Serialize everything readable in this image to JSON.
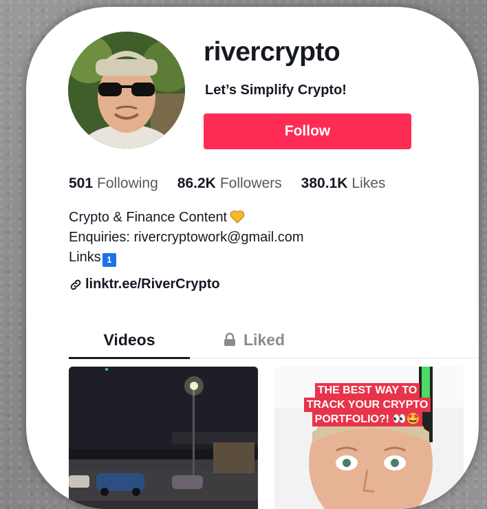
{
  "profile": {
    "username": "rivercrypto",
    "tagline": "Let’s Simplify Crypto!",
    "follow_label": "Follow"
  },
  "stats": [
    {
      "value": "501",
      "label": "Following"
    },
    {
      "value": "86.2K",
      "label": "Followers"
    },
    {
      "value": "380.1K",
      "label": "Likes"
    }
  ],
  "bio": {
    "line1": "Crypto & Finance Content",
    "line2": "Enquiries: rivercryptowork@gmail.com",
    "line3": "Links",
    "keycap": "1"
  },
  "link": {
    "text": "linktr.ee/RiverCrypto"
  },
  "tabs": {
    "videos": "Videos",
    "liked": "Liked"
  },
  "videos": [
    {
      "overlay_lines": []
    },
    {
      "overlay_lines": [
        "THE BEST WAY TO",
        "TRACK YOUR CRYPTO",
        "PORTFOLIO?! 👀🤩"
      ]
    }
  ],
  "colors": {
    "brand_red": "#fe2c55",
    "text_primary": "#161823",
    "text_secondary": "#565862"
  },
  "icons": {
    "heart": "yellow-heart-icon",
    "link": "link-icon",
    "lock": "lock-icon"
  }
}
